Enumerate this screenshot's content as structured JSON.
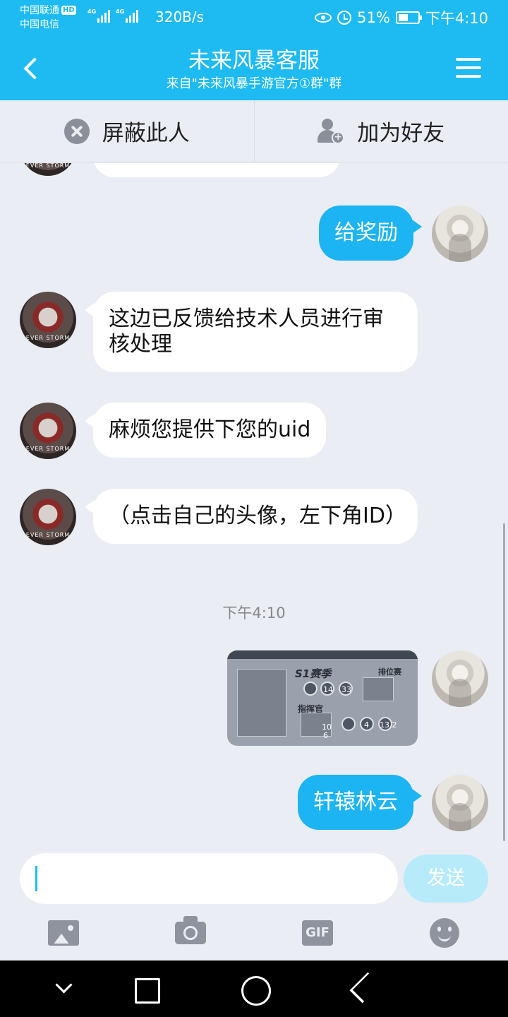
{
  "status_bar": {
    "carrier_1": "中国联通",
    "carrier_1_badge": "HD",
    "carrier_2": "中国电信",
    "network_tag": "4G",
    "net_speed": "320B/s",
    "battery": "51%",
    "battery_level": 0.51,
    "time": "下午4:10"
  },
  "header": {
    "title": "未来风暴客服",
    "subtitle": "来自\"未来风暴手游官方①群\"群"
  },
  "actions": {
    "block_label": "屏蔽此人",
    "add_friend_label": "加为好友"
  },
  "messages": [
    {
      "from": "me",
      "text": "给奖励"
    },
    {
      "from": "them",
      "text": "这边已反馈给技术人员进行审核处理"
    },
    {
      "from": "them",
      "text": "麻烦您提供下您的uid"
    },
    {
      "from": "them",
      "text": "（点击自己的头像，左下角ID）"
    },
    {
      "timestamp": "下午4:10"
    },
    {
      "from": "me",
      "image": {
        "season_title": "S1赛季",
        "ranked_label": "排位赛",
        "commander_label": "指挥官",
        "stat_values": [
          "14",
          "33",
          "4",
          "13.2",
          "10",
          "6"
        ]
      }
    },
    {
      "from": "me",
      "text": "轩辕林云"
    }
  ],
  "composer": {
    "input_value": "",
    "send_label": "发送",
    "gif_label": "GIF"
  },
  "colors": {
    "accent": "#1ebbf3",
    "bubble_out": "#1cb4f2",
    "background": "#eaedf4"
  }
}
